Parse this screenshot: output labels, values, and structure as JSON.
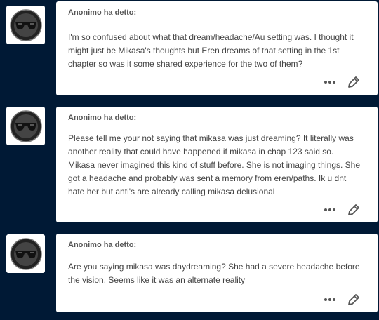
{
  "asks": [
    {
      "asker": "Anonimo ha detto:",
      "text": "I'm so confused about what that dream/headache/Au setting was. I thought it might just be Mikasa's thoughts but Eren dreams of that setting in the 1st chapter so was it some shared experience for the two of them?",
      "avatar_icon": "anonymous-sunglasses-icon",
      "more_icon": "more-options-icon",
      "edit_icon": "pencil-icon"
    },
    {
      "asker": "Anonimo ha detto:",
      "text": "Please tell me your not saying that mikasa was just dreaming? It literally was another reality that could have happened if mikasa in chap 123 said so. Mikasa never imagined this kind of stuff before. She is not imaging things. She got a headache and probably was sent a memory from eren/paths. Ik u dnt hate her but anti's are already calling mikasa delusional",
      "avatar_icon": "anonymous-sunglasses-icon",
      "more_icon": "more-options-icon",
      "edit_icon": "pencil-icon"
    },
    {
      "asker": "Anonimo ha detto:",
      "text": "Are you saying mikasa was daydreaming? She had a severe headache before the vision. Seems like it was an alternate reality",
      "avatar_icon": "anonymous-sunglasses-icon",
      "more_icon": "more-options-icon",
      "edit_icon": "pencil-icon"
    }
  ],
  "colors": {
    "background": "#001935",
    "card": "#ffffff",
    "text": "#444444",
    "icon": "#555555"
  }
}
